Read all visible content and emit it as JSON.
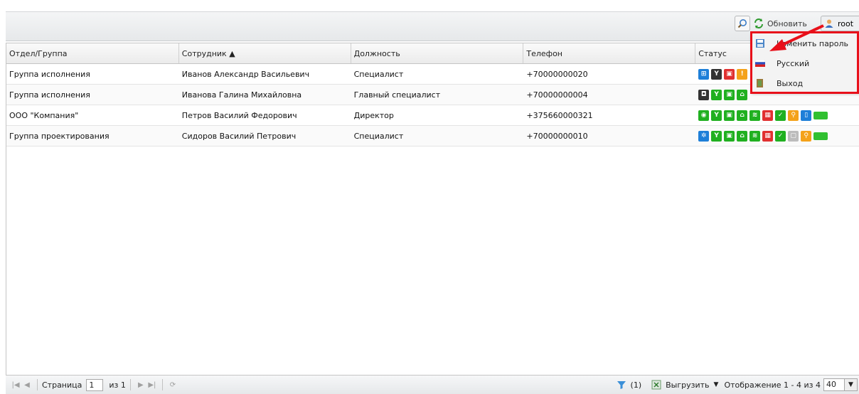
{
  "toolbar": {
    "refresh_label": "Обновить",
    "user_label": "root",
    "icons": {
      "search": "search-icon",
      "refresh": "refresh-icon",
      "user": "user-icon"
    }
  },
  "grid": {
    "columns": [
      "Отдел/Группа",
      "Сотрудник ▲",
      "Должность",
      "Телефон",
      "Статус"
    ],
    "rows": [
      {
        "department": "Группа исполнения",
        "employee": "Иванов Александр Васильевич",
        "position": "Специалист",
        "phone": "+70000000020"
      },
      {
        "department": "Группа исполнения",
        "employee": "Иванова Галина Михайловна",
        "position": "Главный специалист",
        "phone": "+70000000004"
      },
      {
        "department": "ООО \"Компания\"",
        "employee": "Петров Василий Федорович",
        "position": "Директор",
        "phone": "+375660000321"
      },
      {
        "department": "Группа проектирования",
        "employee": "Сидоров Василий Петрович",
        "position": "Специалист",
        "phone": "+70000000010"
      }
    ]
  },
  "user_menu": {
    "items": [
      {
        "label": "Изменить пароль",
        "icon": "save-icon"
      },
      {
        "label": "Русский",
        "icon": "russian-flag-icon"
      },
      {
        "label": "Выход",
        "icon": "exit-door-icon"
      }
    ]
  },
  "pager": {
    "page_label": "Страница",
    "page_value": "1",
    "of_label": "из 1",
    "filter_count": "(1)",
    "export_label": "Выгрузить",
    "display_label": "Отображение 1 - 4 из 4",
    "page_size": "40"
  },
  "colors": {
    "highlight": "#e8101a",
    "status_green": "#20b020",
    "status_red": "#e03030"
  }
}
